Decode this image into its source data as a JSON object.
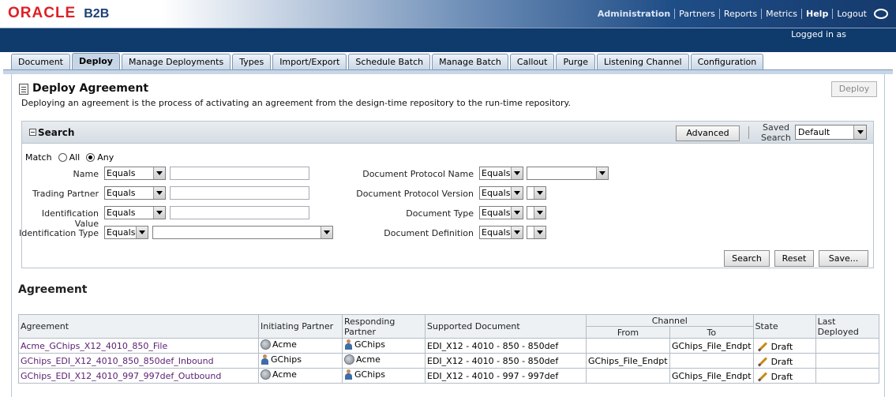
{
  "header": {
    "brand_oracle": "ORACLE",
    "brand_product": "B2B",
    "nav": [
      "Administration",
      "Partners",
      "Reports",
      "Metrics",
      "Help",
      "Logout"
    ],
    "logged_in": "Logged in as"
  },
  "tabs": [
    "Document",
    "Deploy",
    "Manage Deployments",
    "Types",
    "Import/Export",
    "Schedule Batch",
    "Manage Batch",
    "Callout",
    "Purge",
    "Listening Channel",
    "Configuration"
  ],
  "active_tab": "Deploy",
  "page": {
    "title": "Deploy Agreement",
    "description": "Deploying an agreement is the process of activating an agreement from the design-time repository to the run-time repository.",
    "deploy_button": "Deploy"
  },
  "search": {
    "title": "Search",
    "advanced": "Advanced",
    "saved_search_line1": "Saved",
    "saved_search_line2": "Search",
    "saved_search_value": "Default",
    "match_label": "Match",
    "match_all": "All",
    "match_any": "Any",
    "match_selected": "Any",
    "operator_default": "Equals",
    "fields_left": [
      "Name",
      "Trading Partner",
      "Identification Value",
      "Identification Type"
    ],
    "fields_right": [
      "Document Protocol Name",
      "Document Protocol Version",
      "Document Type",
      "Document Definition"
    ],
    "search_button": "Search",
    "reset_button": "Reset",
    "save_button": "Save..."
  },
  "agreements": {
    "title": "Agreement",
    "columns": {
      "agreement": "Agreement",
      "initiating": "Initiating Partner",
      "responding": "Responding Partner",
      "document": "Supported Document",
      "channel": "Channel",
      "from": "From",
      "to": "To",
      "state": "State",
      "last_deployed": "Last Deployed"
    },
    "rows": [
      {
        "agreement": "Acme_GChips_X12_4010_850_File",
        "initiating": "Acme",
        "initiating_icon": "host-icon",
        "responding": "GChips",
        "responding_icon": "person-icon",
        "document": "EDI_X12 - 4010 - 850 - 850def",
        "from": "",
        "to": "GChips_File_Endpt",
        "state": "Draft",
        "last_deployed": ""
      },
      {
        "agreement": "GChips_EDI_X12_4010_850_850def_Inbound",
        "initiating": "GChips",
        "initiating_icon": "person-icon",
        "responding": "Acme",
        "responding_icon": "host-icon",
        "document": "EDI_X12 - 4010 - 850 - 850def",
        "from": "GChips_File_Endpt",
        "to": "",
        "state": "Draft",
        "last_deployed": ""
      },
      {
        "agreement": "GChips_EDI_X12_4010_997_997def_Outbound",
        "initiating": "Acme",
        "initiating_icon": "host-icon",
        "responding": "GChips",
        "responding_icon": "person-icon",
        "document": "EDI_X12 - 4010 - 997 - 997def",
        "from": "",
        "to": "GChips_File_Endpt",
        "state": "Draft",
        "last_deployed": ""
      }
    ]
  }
}
